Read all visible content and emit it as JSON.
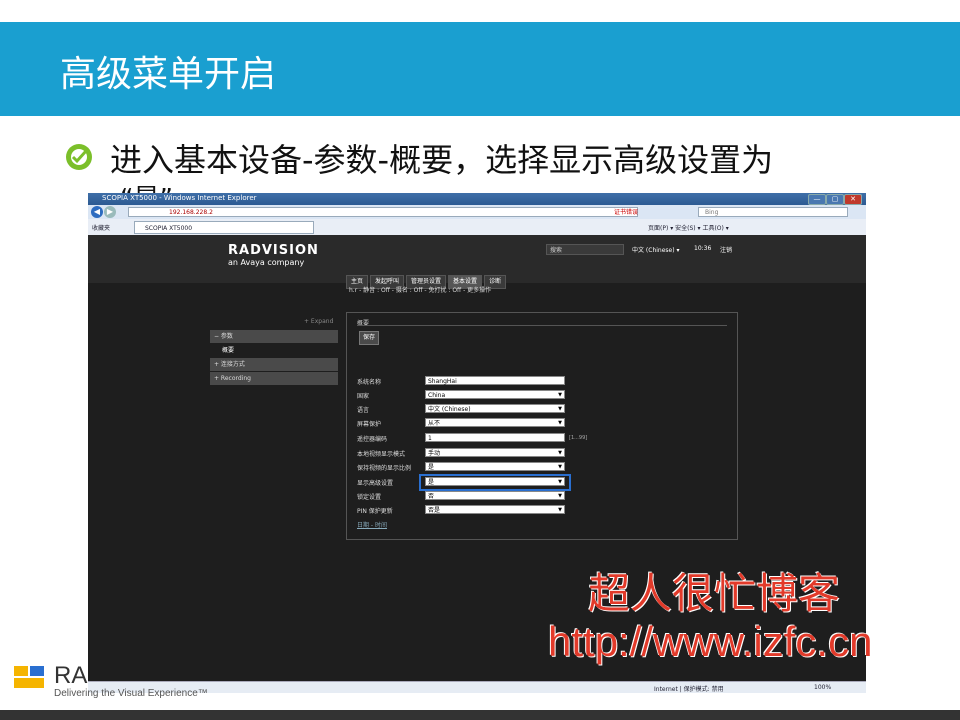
{
  "slide": {
    "title": "高级菜单开启",
    "bullet": "进入基本设备-参数-概要，选择显示高级设置为",
    "bullet_cont": "“是”"
  },
  "browser": {
    "window_title": "SCOPIA XT5000 - Windows Internet Explorer",
    "address": "192.168.228.2",
    "url_status": "证书错误",
    "search_placeholder": "Bing",
    "favorites_label": "收藏夹",
    "tab_label": "SCOPIA XT5000",
    "command_bar": "页面(P) ▾  安全(S) ▾  工具(O) ▾",
    "status_zone": "Internet | 保护模式: 禁用",
    "zoom": "100%",
    "window_buttons": [
      "—",
      "▢",
      "✕"
    ]
  },
  "app": {
    "logo": "RADVISION",
    "logo_sub": "an Avaya company",
    "search_placeholder": "搜索",
    "language": "中文 (Chinese) ▾",
    "time": "10:36",
    "logout": "注销",
    "nav_tabs": [
      "主页",
      "发起呼叫",
      "管理员设置",
      "基本设置",
      "诊断"
    ],
    "active_tab": "基本设置",
    "status_line": "h.r - 静音 : Off - 摄名 : Off - 免打扰 : Off - 更多操作",
    "expand": "+ Expand",
    "sidebar": [
      {
        "label": "− 参数",
        "kind": "section"
      },
      {
        "label": "概要",
        "kind": "sub"
      },
      {
        "label": "+ 连接方式",
        "kind": "section"
      },
      {
        "label": "+ Recording",
        "kind": "section"
      }
    ]
  },
  "panel": {
    "title": "概要",
    "save": "保存",
    "rows": [
      {
        "label": "系统名称",
        "value": "ShangHai",
        "type": "text"
      },
      {
        "label": "国家",
        "value": "China",
        "type": "select"
      },
      {
        "label": "语言",
        "value": "中文 (Chinese)",
        "type": "select"
      },
      {
        "label": "屏幕保护",
        "value": "从不",
        "type": "select"
      },
      {
        "label": "遥控器编码",
        "value": "1",
        "type": "text"
      },
      {
        "label": "本地视频显示模式",
        "value": "手动",
        "type": "select"
      },
      {
        "label": "保持视频的显示比例",
        "value": "是",
        "type": "select"
      },
      {
        "label": "显示高级设置",
        "value": "是",
        "type": "select"
      },
      {
        "label": "锁定设置",
        "value": "否",
        "type": "select"
      },
      {
        "label": "PIN 保护更新",
        "value": "否是",
        "type": "select"
      }
    ],
    "range_hint": "[1...99]",
    "more_link": "日期 - 时间"
  },
  "watermark": {
    "line1": "超人很忙博客",
    "line2": "http://www.izfc.cn"
  },
  "footer": {
    "brand": "RA",
    "tagline": "Delivering the Visual Experience™"
  },
  "colors": {
    "header_blue": "#1a9fd0",
    "watermark_red": "#e23a2a",
    "highlight_blue": "#2a6fd0"
  }
}
